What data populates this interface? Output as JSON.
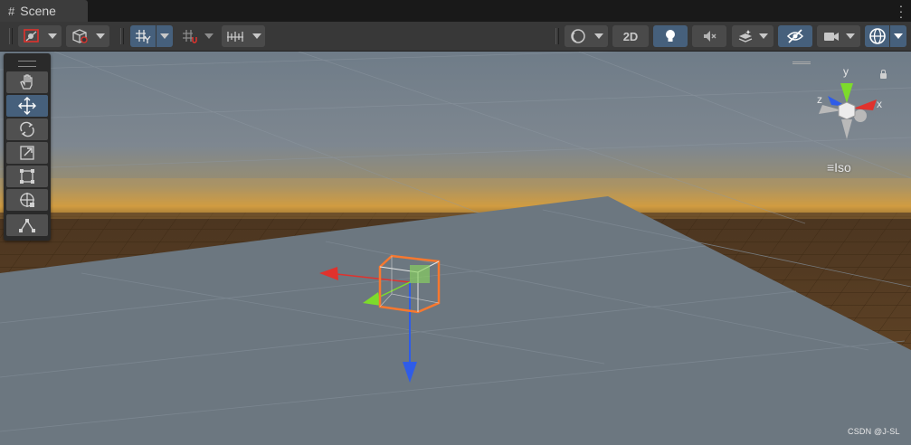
{
  "window": {
    "tab_title": "Scene",
    "tab_icon": "grid-hash-icon",
    "menu_icon": "vertical-dots-icon"
  },
  "toolbar": {
    "left_groups": [
      {
        "name": "draw-mode",
        "icon": "shaded-draw-mode-icon",
        "has_dropdown": true
      },
      {
        "name": "render-mode",
        "icon": "wireframe-cube-icon",
        "has_dropdown": true
      },
      {
        "name": "grid-snapping",
        "icon": "grid-snap-icon",
        "has_dropdown": true,
        "active": true
      },
      {
        "name": "increment-snap",
        "icon": "increment-snap-icon",
        "has_dropdown": true
      },
      {
        "name": "grid-visibility",
        "icon": "grid-ruler-icon",
        "has_dropdown": true
      }
    ],
    "right_groups": [
      {
        "name": "shading",
        "icon": "sphere-shading-icon",
        "has_dropdown": true
      },
      {
        "name": "2d-toggle",
        "label": "2D"
      },
      {
        "name": "lighting",
        "icon": "light-bulb-icon",
        "active": true
      },
      {
        "name": "audio",
        "icon": "speaker-mute-icon"
      },
      {
        "name": "effects",
        "icon": "layers-effects-icon",
        "has_dropdown": true
      },
      {
        "name": "hidden-objects",
        "icon": "eye-slash-icon",
        "active": true
      },
      {
        "name": "camera",
        "icon": "camera-icon",
        "has_dropdown": true
      },
      {
        "name": "gizmos",
        "icon": "globe-gizmo-icon",
        "has_dropdown": true,
        "active": true
      }
    ]
  },
  "tools_overlay": {
    "tools": [
      {
        "name": "hand-tool",
        "icon": "hand-icon"
      },
      {
        "name": "move-tool",
        "icon": "move-arrows-icon",
        "selected": true
      },
      {
        "name": "rotate-tool",
        "icon": "rotate-icon"
      },
      {
        "name": "scale-tool",
        "icon": "scale-icon"
      },
      {
        "name": "rect-tool",
        "icon": "rect-transform-icon"
      },
      {
        "name": "transform-tool",
        "icon": "transform-icon"
      },
      {
        "name": "custom-tool",
        "icon": "custom-editor-tool-icon"
      }
    ]
  },
  "orientation_gizmo": {
    "axes": [
      "y",
      "z",
      "x"
    ],
    "projection_label": "Iso"
  },
  "colors": {
    "x_axis": "#e0322d",
    "y_axis": "#7ddb2b",
    "z_axis": "#2f5ce8",
    "selection_outline": "#f7782f",
    "active_button": "#46607c"
  },
  "watermark": "CSDN @J-SL"
}
